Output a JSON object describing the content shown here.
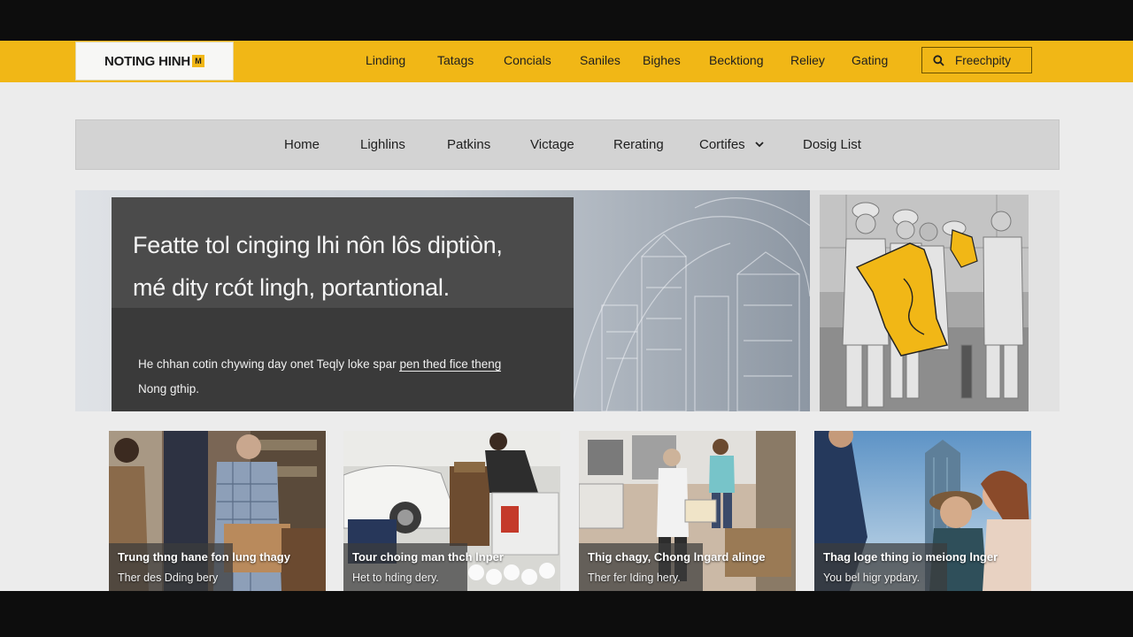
{
  "logo": {
    "text": "NOTING HINH",
    "mark": "M"
  },
  "topnav": {
    "items": [
      "Linding",
      "Tatags",
      "Concials",
      "Saniles",
      "Bighes",
      "Becktiong",
      "Reliey",
      "Gating"
    ],
    "search_label": "Freechpity"
  },
  "subnav": {
    "items": [
      "Home",
      "Lighlins",
      "Patkins",
      "Victage",
      "Rerating",
      "Cortifes",
      "Dosig List"
    ]
  },
  "hero": {
    "title_line1": "Featte tol cinging lhi nôn lôs diptiòn,",
    "title_line2": "mé dity rcót lingh, portantional.",
    "text_line1_a": "He chhan cotin chywing day onet Teqly loke spar ",
    "text_line1_link": "pen thed fice theng",
    "text_line2": "Nong gthip."
  },
  "cards": [
    {
      "title": "Trung thng hane fon lung thagy",
      "subtitle": "Ther des Dding bery"
    },
    {
      "title": "Tour choing man thch lnper",
      "subtitle": "Het to hding dery."
    },
    {
      "title": "Thig chagy, Chong lngard alinge",
      "subtitle": "Ther fer Iding hery."
    },
    {
      "title": "Thag loge thing io meiong lnger",
      "subtitle": "You bel higr ypdary."
    }
  ],
  "colors": {
    "brand": "#f1b716",
    "hero_card": "#3a3a3a",
    "subnav": "#d3d3d3"
  },
  "icons": [
    "search-icon",
    "chevron-down-icon"
  ]
}
